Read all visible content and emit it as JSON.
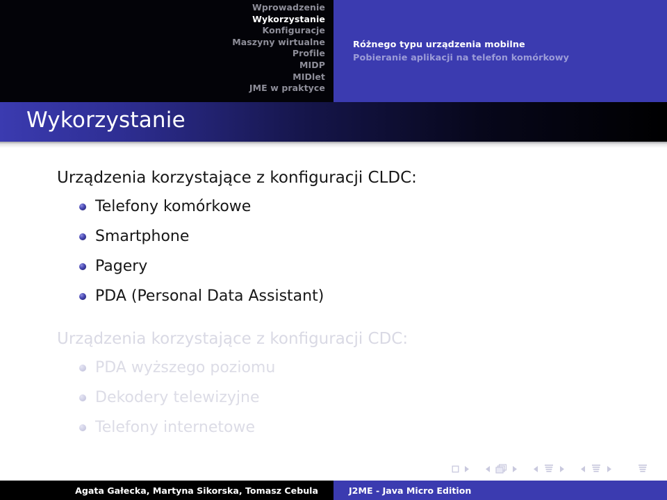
{
  "header": {
    "nav_items": [
      {
        "label": "Wprowadzenie",
        "active": false
      },
      {
        "label": "Wykorzystanie",
        "active": true
      },
      {
        "label": "Konfiguracje",
        "active": false
      },
      {
        "label": "Maszyny wirtualne",
        "active": false
      },
      {
        "label": "Profile",
        "active": false
      },
      {
        "label": "MIDP",
        "active": false
      },
      {
        "label": "MIDlet",
        "active": false
      },
      {
        "label": "JME w praktyce",
        "active": false
      }
    ],
    "subsections": [
      {
        "label": "Różnego typu urządzenia mobilne",
        "active": true
      },
      {
        "label": "Pobieranie aplikacji na telefon komórkowy",
        "active": false
      }
    ]
  },
  "title_bar": {
    "title": "Wykorzystanie"
  },
  "content": {
    "blocks": [
      {
        "lead": "Urządzenia korzystające z konfiguracji CLDC:",
        "faded": false,
        "items": [
          "Telefony komórkowe",
          "Smartphone",
          "Pagery",
          "PDA (Personal Data Assistant)"
        ]
      },
      {
        "lead": "Urządzenia korzystające z konfiguracji CDC:",
        "faded": true,
        "items": [
          "PDA wyższego poziomu",
          "Dekodery telewizyjne",
          "Telefony internetowe"
        ]
      }
    ]
  },
  "nav_symbols": [
    {
      "name": "first-slide-icon"
    },
    {
      "name": "prev-slide-icon"
    },
    {
      "name": "next-slide-icon"
    },
    {
      "name": "prev-frame-icon"
    },
    {
      "name": "frame-icon"
    },
    {
      "name": "next-frame-icon"
    },
    {
      "name": "prev-subsection-icon"
    },
    {
      "name": "subsection-icon"
    },
    {
      "name": "next-subsection-icon"
    },
    {
      "name": "prev-section-icon"
    },
    {
      "name": "section-icon"
    },
    {
      "name": "next-section-icon"
    },
    {
      "name": "presentation-icon"
    },
    {
      "name": "back-icon"
    },
    {
      "name": "search-icon"
    },
    {
      "name": "forward-icon"
    }
  ],
  "footer": {
    "authors": "Agata Gałecka, Martyna Sikorska, Tomasz Cebula",
    "talk_title": "J2ME - Java Micro Edition"
  },
  "colors": {
    "brand_blue": "#3b3bb0",
    "header_black": "#030308",
    "nav_inactive": "#8e8e99",
    "subsec_dim": "#9c9cd8",
    "faded_text": "#dcdce6",
    "body_text": "#171717"
  }
}
